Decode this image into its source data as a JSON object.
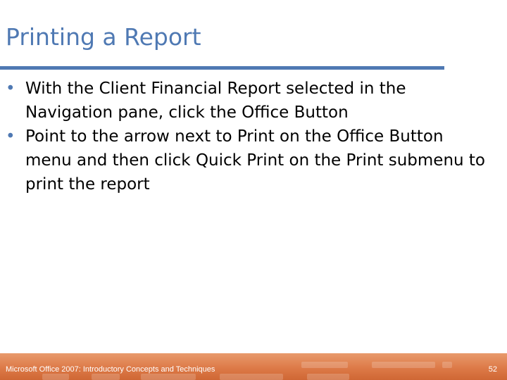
{
  "slide": {
    "title": "Printing a Report",
    "bullets": [
      "With the Client Financial Report selected in the Navigation pane, click the Office Button",
      "Point to the arrow next to Print on the Office Button menu and then click Quick Print on the Print submenu to print the report"
    ],
    "bullet_glyph": "•"
  },
  "footer": {
    "caption": "Microsoft Office 2007: Introductory Concepts and Techniques",
    "page_number": "52"
  },
  "colors": {
    "title": "#4f79b3",
    "footer_bar": "#dd7a48",
    "footer_text": "#ffffff"
  }
}
